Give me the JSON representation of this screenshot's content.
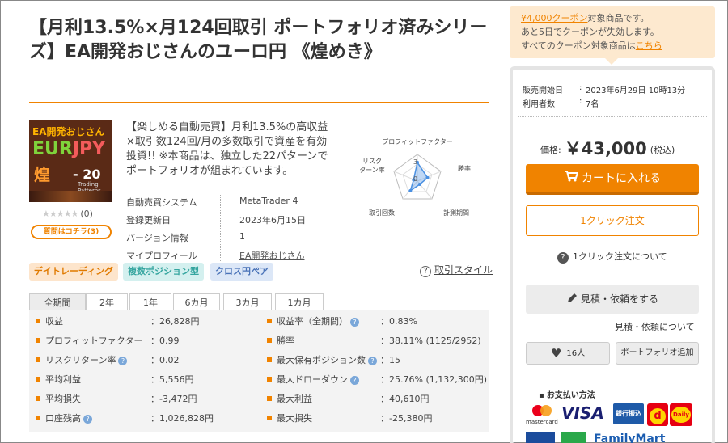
{
  "product": {
    "title": "【月利13.5%×月124回取引 ポートフォリオ済みシリーズ】EA開発おじさんのユーロ円 《煌めき》",
    "thumbnail": {
      "line1": "EA開発おじさん",
      "eur": "EUR",
      "jpy": "JPY",
      "kanji": "煌",
      "number": "- 20",
      "sub1": "Trading",
      "sub2": "Patterns"
    },
    "rating": {
      "stars": "★★★★★",
      "count": "(0)"
    },
    "qa_button": "質問はコチラ(3)",
    "description": "【楽しめる自動売買】月利13.5%の高収益×取引数124回/月の多数取引で資産を有効投資!! ※本商品は、独立した22パターンでポートフォリオが組まれています。",
    "specs": [
      {
        "key": "自動売買システム",
        "value": "MetaTrader 4"
      },
      {
        "key": "登録更新日",
        "value": "2023年6月15日"
      },
      {
        "key": "バージョン情報",
        "value": "1"
      },
      {
        "key": "マイプロフィール",
        "value": "EA開発おじさん"
      }
    ],
    "tags": [
      "デイトレーディング",
      "複数ポジション型",
      "クロス円ペア"
    ],
    "style_link": "取引スタイル"
  },
  "radar": {
    "labels": {
      "profit_factor": "プロフィットファクター",
      "win_rate": "勝率",
      "period": "計測期間",
      "trades": "取引回数",
      "risk_return": "リスク\nターン率"
    },
    "scale_labels": [
      "3",
      "0"
    ],
    "values": {
      "profit_factor": 0.7,
      "win_rate": 0.4,
      "period": 0.15,
      "trades": 0.45,
      "risk_return": 0.15
    },
    "accent": "#4a90e2"
  },
  "tabs": [
    "全期間",
    "2年",
    "1年",
    "6カ月",
    "3カ月",
    "1カ月"
  ],
  "stats": {
    "left": [
      {
        "label": "収益",
        "value": "26,828円",
        "help": false
      },
      {
        "label": "プロフィットファクター",
        "value": "0.99",
        "help": false
      },
      {
        "label": "リスクリターン率",
        "value": "0.02",
        "help": true
      },
      {
        "label": "平均利益",
        "value": "5,556円",
        "help": false
      },
      {
        "label": "平均損失",
        "value": "-3,472円",
        "help": false
      },
      {
        "label": "口座残高",
        "value": "1,026,828円",
        "help": true
      }
    ],
    "right": [
      {
        "label": "収益率（全期間）",
        "value": "0.83%",
        "help": true
      },
      {
        "label": "勝率",
        "value": "38.11% (1125/2952)",
        "help": false
      },
      {
        "label": "最大保有ポジション数",
        "value": "15",
        "help": true
      },
      {
        "label": "最大ドローダウン",
        "value": "25.76% (1,132,300円)",
        "help": true
      },
      {
        "label": "最大利益",
        "value": "40,610円",
        "help": false
      },
      {
        "label": "最大損失",
        "value": "-25,380円",
        "help": false
      }
    ]
  },
  "coupon": {
    "link": "¥4,000クーポン",
    "line1_rest": "対象商品です。",
    "line2": "あと5日でクーポンが失効します。",
    "line3_pre": "すべてのクーポン対象商品は",
    "line3_link": "こちら"
  },
  "sale": {
    "start_label": "販売開始日",
    "start_value": "2023年6月29日 10時13分",
    "users_label": "利用者数",
    "users_value": "7名"
  },
  "purchase": {
    "price_label": "価格:",
    "price": "￥43,000",
    "tax": "(税込)",
    "cart_button": "カートに入れる",
    "oneclick_button": "1クリック注文",
    "oneclick_about": "1クリック注文について",
    "quote_button": "見積・依頼をする",
    "quote_link": "見積・依頼について",
    "like_count": "16人",
    "portfolio_button": "ポートフォリオ追加",
    "payment_title": "お支払い方法",
    "payment_logos": {
      "mastercard": "mastercard",
      "visa": "VISA",
      "bank": "銀行振込",
      "d": "d",
      "daily": "Daily",
      "familymart": "FamilyMart"
    }
  },
  "colors": {
    "accent": "#f08300",
    "link_blue": "#4a73b8"
  }
}
